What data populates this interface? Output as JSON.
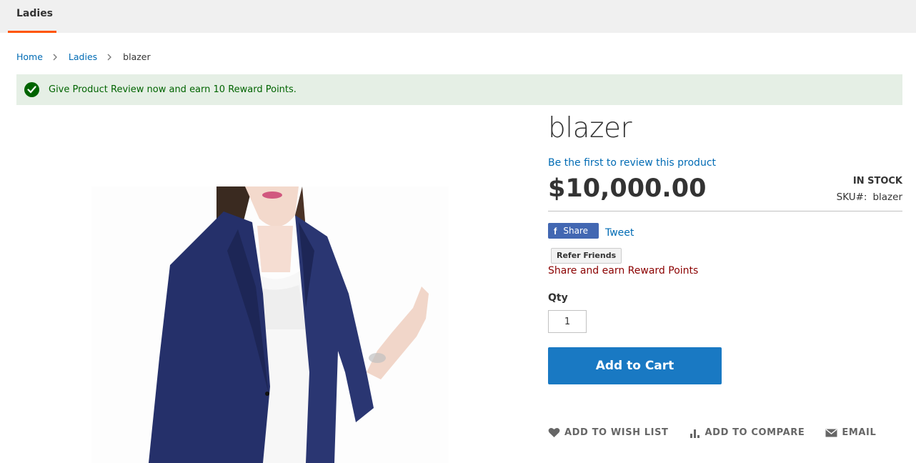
{
  "nav": {
    "tab_label": "Ladies"
  },
  "breadcrumb": {
    "home": "Home",
    "category": "Ladies",
    "current": "blazer"
  },
  "message": {
    "text": "Give Product Review now and earn 10 Reward Points."
  },
  "product": {
    "title": "blazer",
    "review_link": "Be the first to review this product",
    "price": "$10,000.00",
    "stock": "In stock",
    "sku_label": "SKU#:",
    "sku_value": "blazer"
  },
  "social": {
    "share_label": "Share",
    "tweet_label": "Tweet"
  },
  "refer": {
    "button_label": "Refer Friends",
    "note": "Share and earn Reward Points"
  },
  "qty": {
    "label": "Qty",
    "value": "1"
  },
  "cart": {
    "button_label": "Add to Cart"
  },
  "actions": {
    "wishlist": "Add to Wish List",
    "compare": "Add to Compare",
    "email": "Email"
  },
  "colors": {
    "accent": "#ff5501",
    "link": "#006bb4",
    "primary_button": "#1979c3",
    "success_bg": "#e5efe5",
    "success_text": "#006400",
    "facebook": "#4267b2"
  }
}
